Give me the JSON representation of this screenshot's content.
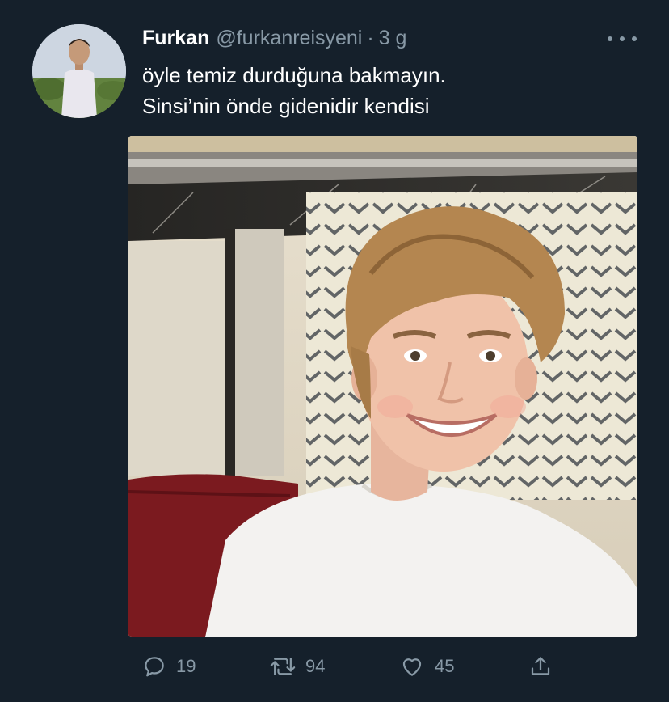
{
  "tweet": {
    "author_name": "Furkan",
    "handle": "@furkanreisyeni",
    "separator": "·",
    "time": "3 g",
    "text_lines": [
      "öyle temiz durduğuna bakmayın.",
      "Sinsi’nin önde gidenidir kendisi"
    ]
  },
  "actions": {
    "reply_count": "19",
    "retweet_count": "94",
    "like_count": "45"
  },
  "icons": {
    "more": "more-horizontal-icon",
    "reply": "reply-icon",
    "retweet": "retweet-icon",
    "like": "heart-icon",
    "share": "share-icon"
  },
  "colors": {
    "background": "#15202b",
    "secondary_text": "#8899a6",
    "primary_text": "#ffffff"
  }
}
